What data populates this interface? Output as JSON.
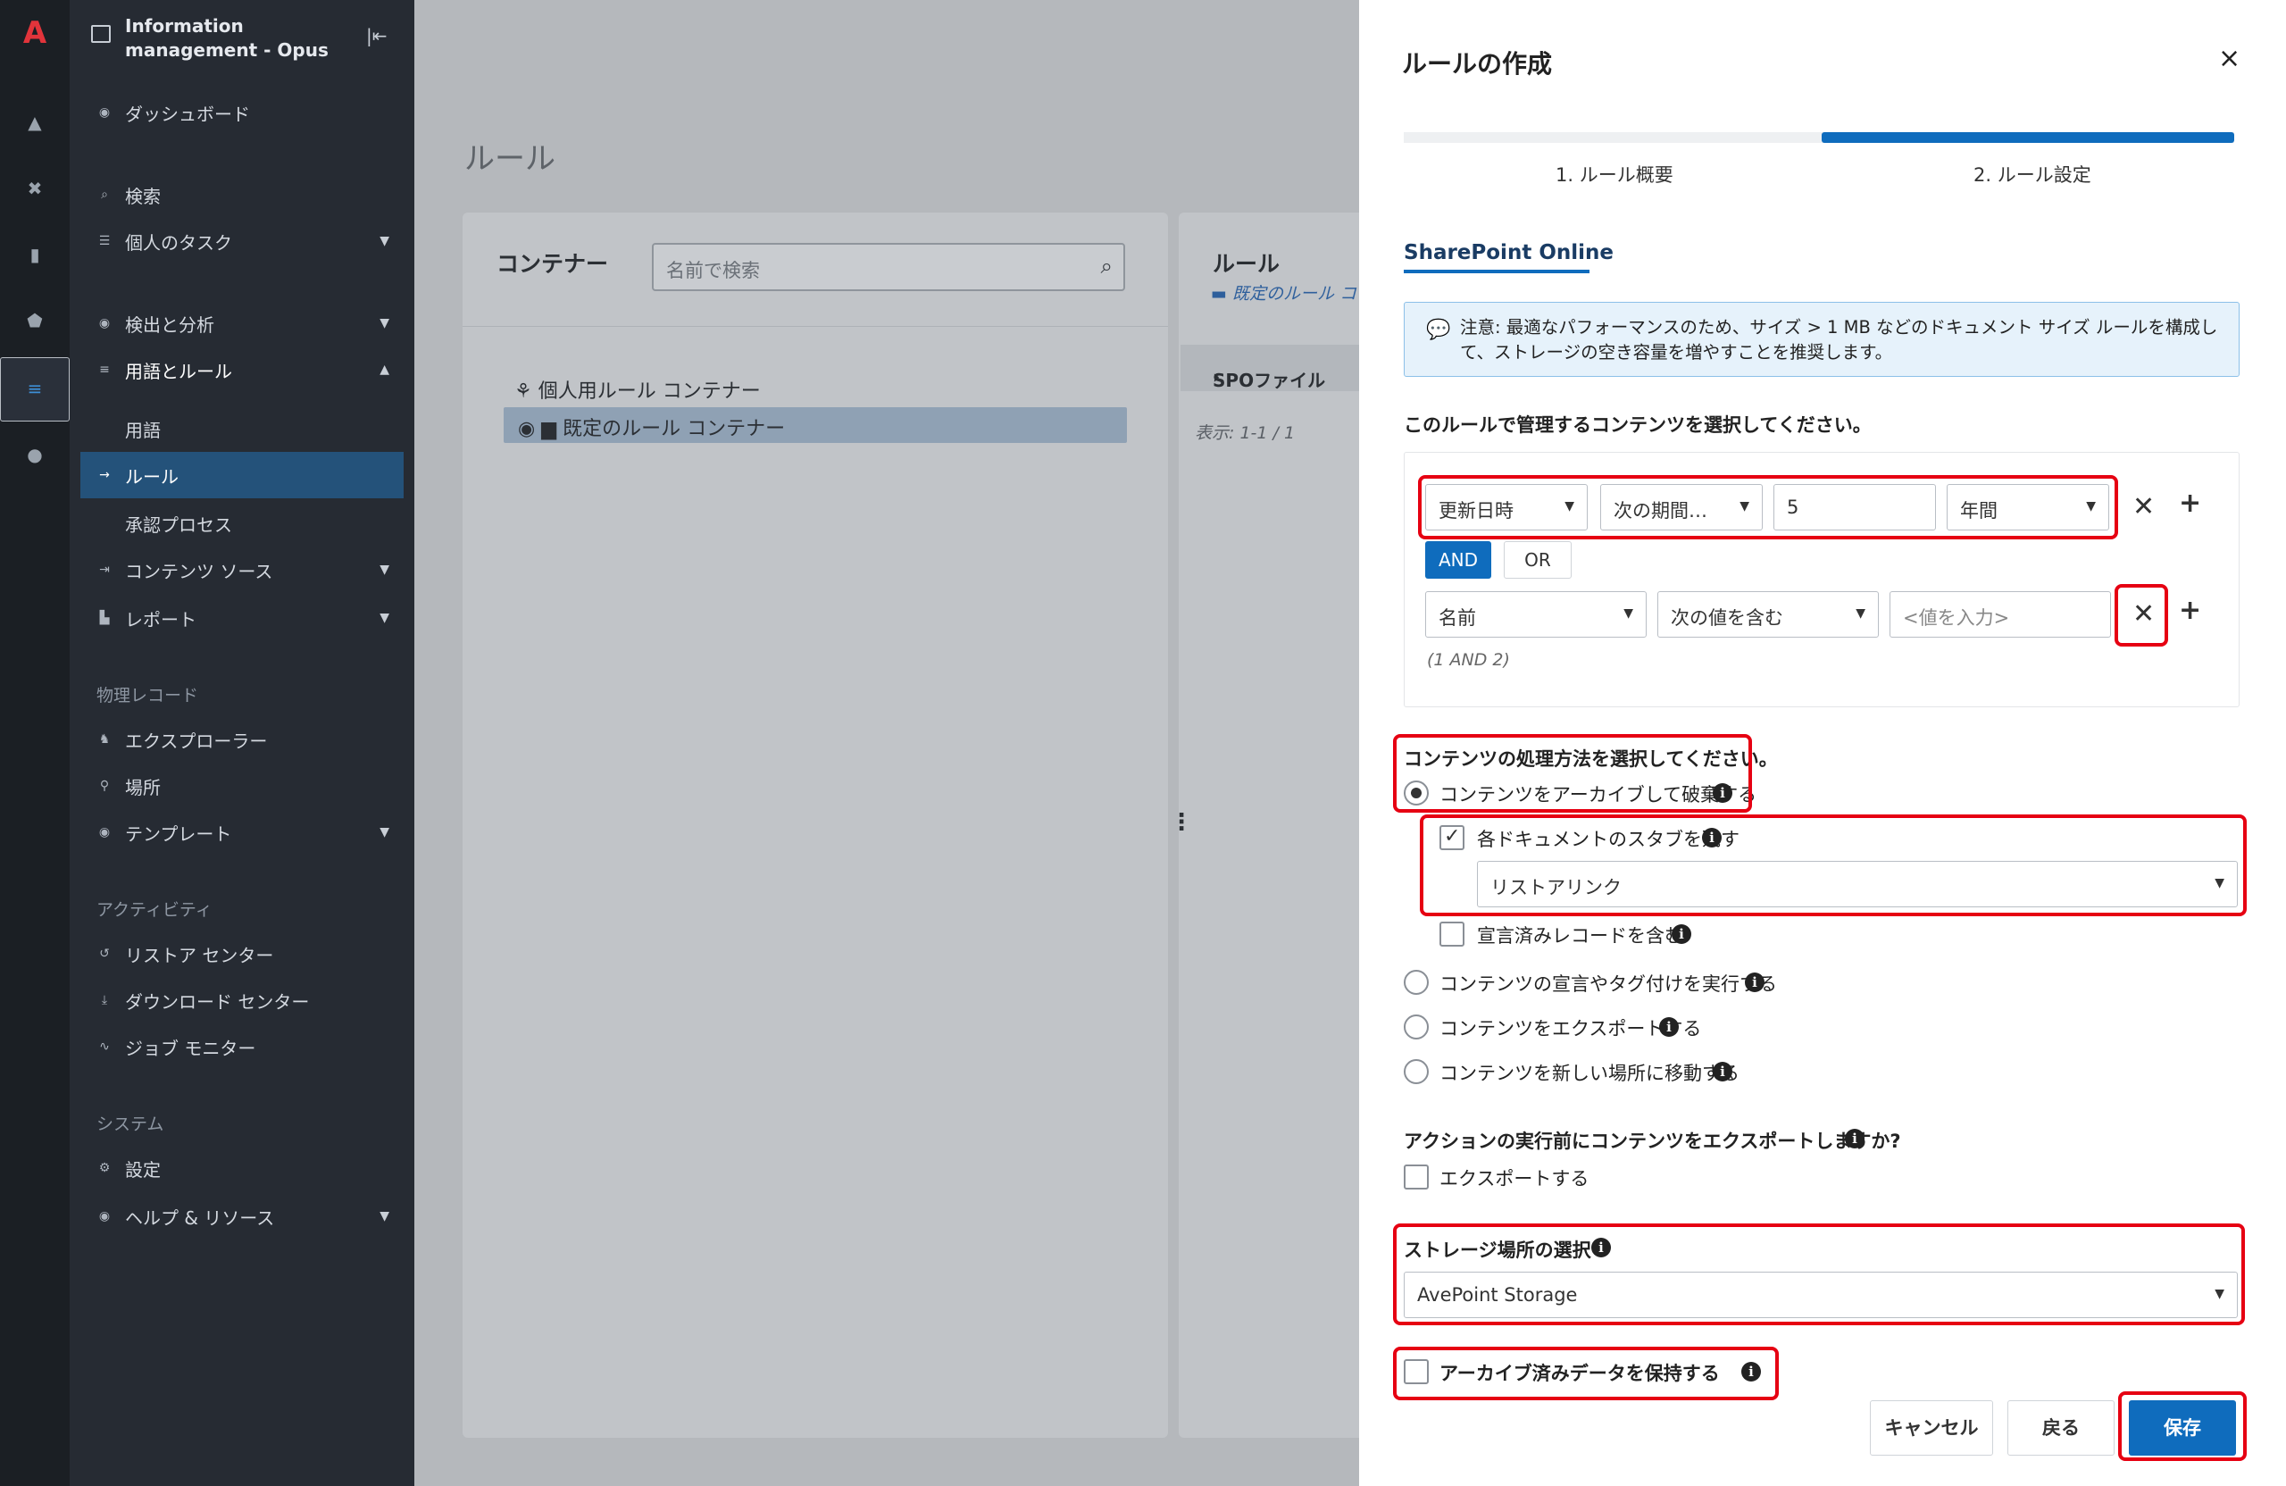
{
  "app": {
    "name": "Information management - Opus"
  },
  "nav": {
    "dashboard": "ダッシュボード",
    "search": "検索",
    "tasks": "個人のタスク",
    "detect": "検出と分析",
    "terms_rules": "用語とルール",
    "terms": "用語",
    "rules": "ルール",
    "approval": "承認プロセス",
    "content_source": "コンテンツ ソース",
    "report": "レポート",
    "section_physical": "物理レコード",
    "explorer": "エクスプローラー",
    "location": "場所",
    "template": "テンプレート",
    "section_activity": "アクティビティ",
    "restore_center": "リストア センター",
    "download_center": "ダウンロード センター",
    "job_monitor": "ジョブ モニター",
    "section_system": "システム",
    "settings": "設定",
    "help": "ヘルプ & リソース"
  },
  "main": {
    "title": "ルール",
    "container_title": "コンテナー",
    "search_placeholder": "名前で検索",
    "tree_root": "個人用ルール コンテナー",
    "tree_selected": "既定のルール コンテナー",
    "rule_title": "ルール",
    "rule_sub": "既定のルール コンテナー",
    "spo_row": "SPOファイル",
    "display_count": "表示: 1-1 / 1"
  },
  "drawer": {
    "title": "ルールの作成",
    "close": "×",
    "steps": [
      "1. ルール概要",
      "2. ルール設定"
    ],
    "progress": 1.0,
    "tab": "SharePoint Online",
    "note": "注意: 最適なパフォーマンスのため、サイズ > 1 MB などのドキュメント サイズ ルールを構成して、ストレージの空き容量を増やすことを推奨します。",
    "q_content": "このルールで管理するコンテンツを選択してください。",
    "cond1": {
      "field": "更新日時",
      "op": "次の期間…",
      "value": "5",
      "unit": "年間"
    },
    "and_label": "AND",
    "or_label": "OR",
    "cond2": {
      "field": "名前",
      "op": "次の値を含む",
      "placeholder": "<値を入力>"
    },
    "expression": "(1 AND 2)",
    "q_process": "コンテンツの処理方法を選択してください。",
    "opt_archive": "コンテンツをアーカイブして破棄する",
    "chk_stub": "各ドキュメントのスタブを残す",
    "stub_type": "リストアリンク",
    "chk_declared": "宣言済みレコードを含む",
    "opt_declare": "コンテンツの宣言やタグ付けを実行する",
    "opt_export": "コンテンツをエクスポートする",
    "opt_move": "コンテンツを新しい場所に移動する",
    "q_export": "アクションの実行前にコンテンツをエクスポートしますか?",
    "chk_export": "エクスポートする",
    "storage_label": "ストレージ場所の選択",
    "storage_value": "AvePoint Storage",
    "chk_keep": "アーカイブ済みデータを保持する",
    "btn_cancel": "キャンセル",
    "btn_back": "戻る",
    "btn_save": "保存"
  },
  "colors": {
    "accent": "#0f6cbd",
    "highlight": "#e60012",
    "nav_bg": "#262b33"
  }
}
